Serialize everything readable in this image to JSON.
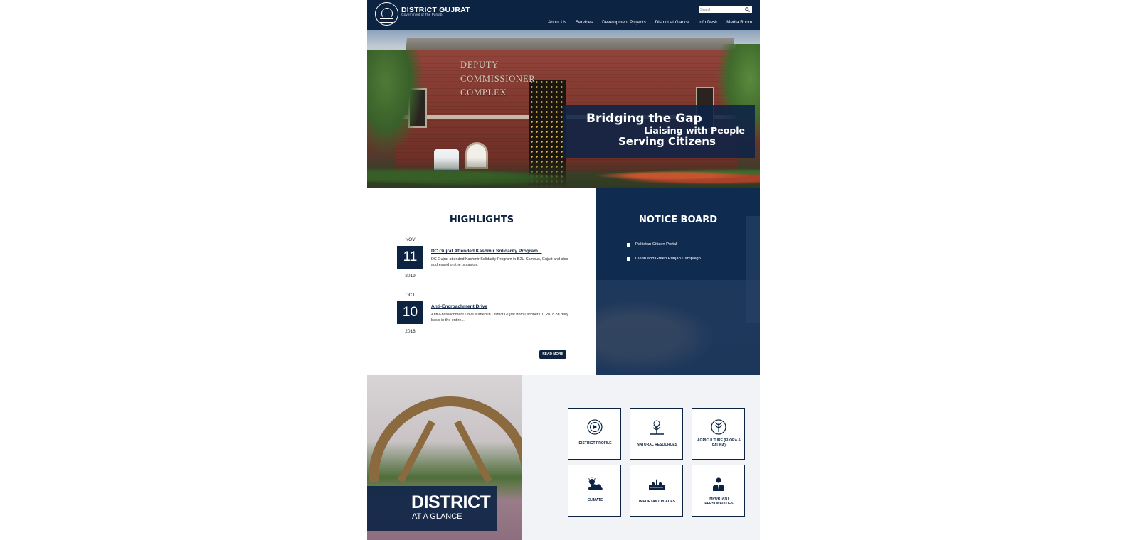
{
  "header": {
    "title": "DISTRICT GUJRAT",
    "subtitle": "Government of The Punjab",
    "search_placeholder": "Search",
    "nav": [
      "About Us",
      "Services",
      "Development Projects",
      "District at Glance",
      "Info Desk",
      "Media Room"
    ]
  },
  "hero": {
    "building_name": [
      "DEPUTY",
      "COMMISSIONER",
      "COMPLEX"
    ],
    "banner_lines": [
      "Bridging the Gap",
      "Liaising with People",
      "Serving Citizens"
    ]
  },
  "highlights": {
    "title": "HIGHLIGHTS",
    "items": [
      {
        "month": "NOV",
        "day": "11",
        "year": "2019",
        "title": "DC Gujrat Attended Kashmir Solidarity Program...",
        "text": "DC Gujrat attended Kashmir Solidarity Program in B2U Campus, Gujrat and also addressed on the occasion."
      },
      {
        "month": "OCT",
        "day": "10",
        "year": "2018",
        "title": "Anti-Encroachment Drive",
        "text": "Anti-Encroachment Drive started in District Gujrat from October 01, 2018 on daily basis in the entire..."
      }
    ],
    "read_more": "READ MORE"
  },
  "notice_board": {
    "title": "NOTICE BOARD",
    "items": [
      "Pakistan Citizen Portal",
      "Clean and Green Punjab Campaign"
    ]
  },
  "glance": {
    "banner_line1": "DISTRICT",
    "banner_line2": "AT A GLANCE",
    "tiles": [
      {
        "label": "DISTRICT PROFILE",
        "icon": "district-profile-icon"
      },
      {
        "label": "NATURAL RESOURCES",
        "icon": "tree-icon"
      },
      {
        "label": "AGRICULTURE (FLORA & FAUNA)",
        "icon": "leaf-icon"
      },
      {
        "label": "CLIMATE",
        "icon": "cloud-sun-icon"
      },
      {
        "label": "IMPORTANT PLACES",
        "icon": "building-icon"
      },
      {
        "label": "IMPORTANT PERSONALITIES",
        "icon": "person-icon"
      }
    ]
  },
  "colors": {
    "primary": "#0c2341",
    "notice_bg": "#102b50",
    "panel_bg": "#f1f3f6"
  }
}
